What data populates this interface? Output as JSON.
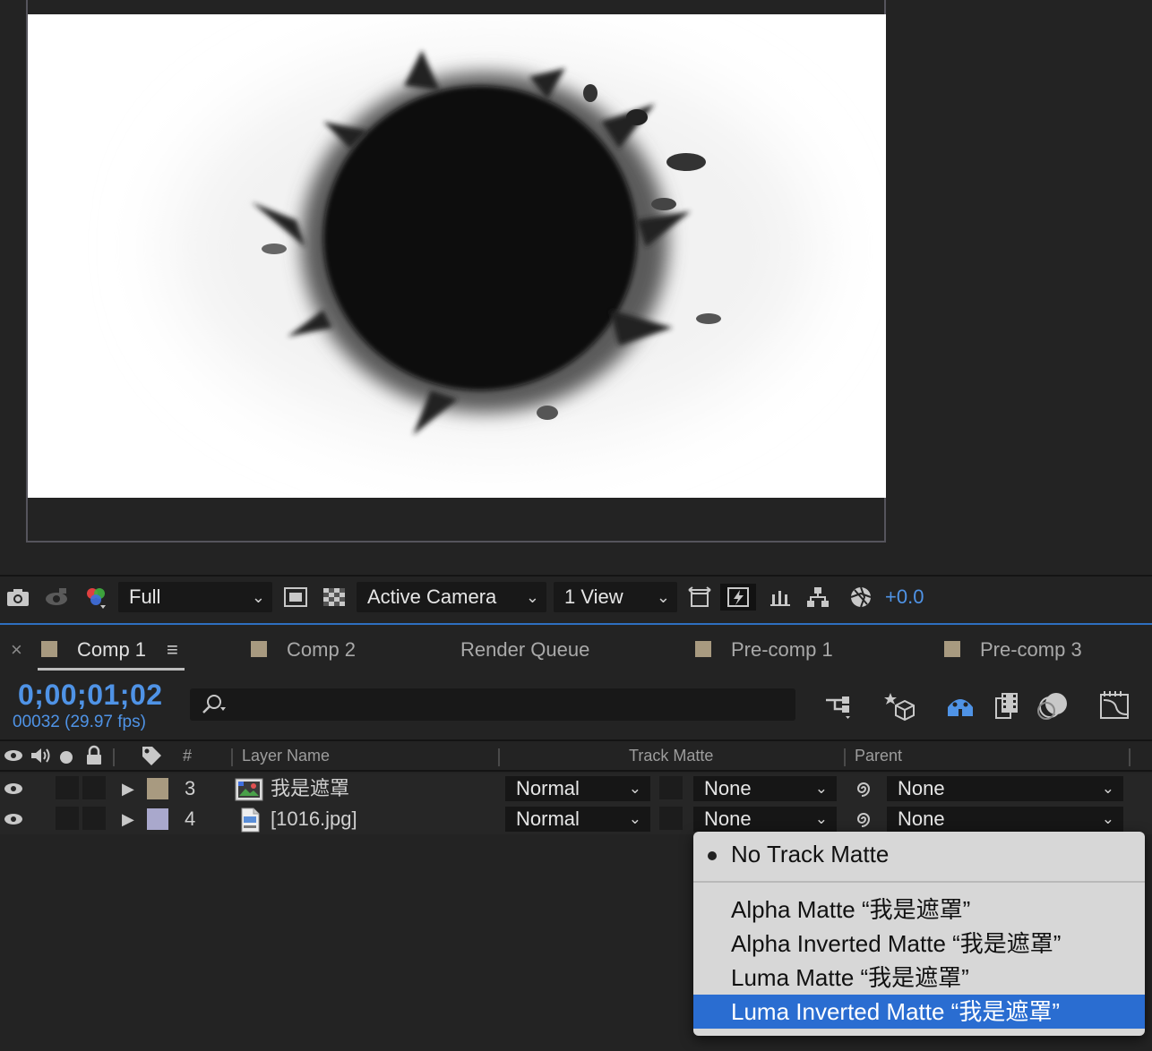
{
  "viewer_toolbar": {
    "resolution": "Full",
    "camera": "Active Camera",
    "views": "1 View",
    "exposure": "+0.0"
  },
  "tabs": [
    {
      "label": "Comp 1",
      "active": true,
      "swatch": "#a89a80",
      "menu_glyph": "≡",
      "close_glyph": "×"
    },
    {
      "label": "Comp 2",
      "active": false,
      "swatch": "#a89a80"
    },
    {
      "label": "Render Queue",
      "active": false
    },
    {
      "label": "Pre-comp 1",
      "active": false,
      "swatch": "#a89a80"
    },
    {
      "label": "Pre-comp 3",
      "active": false,
      "swatch": "#a89a80"
    }
  ],
  "timeline": {
    "timecode": "0;00;01;02",
    "frame_info": "00032 (29.97 fps)",
    "search_placeholder": ""
  },
  "columns": {
    "number": "#",
    "layer_name": "Layer Name",
    "track_matte": "Track Matte",
    "parent": "Parent"
  },
  "layers": [
    {
      "number": "3",
      "name": "我是遮罩",
      "label_color": "#a89a80",
      "mode": "Normal",
      "matte": "None",
      "parent": "None"
    },
    {
      "number": "4",
      "name": "[1016.jpg]",
      "label_color": "#a9a8cc",
      "mode": "Normal",
      "matte": "None",
      "parent": "None"
    }
  ],
  "track_matte_menu": {
    "items": [
      {
        "label": "No Track Matte",
        "checked": true
      },
      {
        "label": "Alpha Matte “我是遮罩”"
      },
      {
        "label": "Alpha Inverted Matte “我是遮罩”"
      },
      {
        "label": "Luma Matte “我是遮罩”"
      },
      {
        "label": "Luma Inverted Matte “我是遮罩”",
        "highlighted": true
      }
    ]
  },
  "colors": {
    "accent": "#4f93e6",
    "menu_highlight": "#2a6dd1",
    "panel_bg": "#232323"
  }
}
